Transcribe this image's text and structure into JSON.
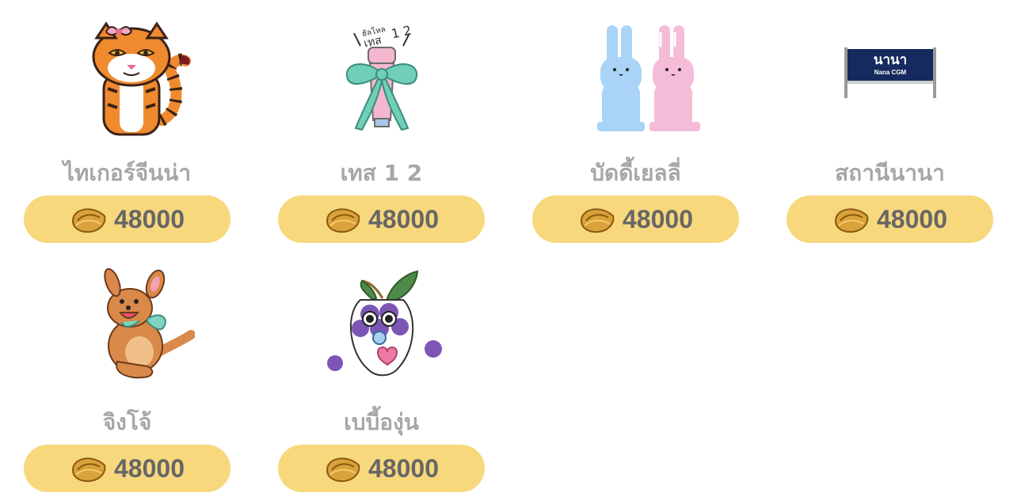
{
  "currency": {
    "icon": "fortune-cookie-icon",
    "color": "#c6952a"
  },
  "items": [
    {
      "name": "ไทเกอร์จีนน่า",
      "price": "48000",
      "icon": "tiger-sticker"
    },
    {
      "name": "เทส 1 2",
      "price": "48000",
      "icon": "microphone-bow-sticker",
      "sticker_text": "ฮัลโหล เทส 1 2"
    },
    {
      "name": "บัดดี้เยลลี่",
      "price": "48000",
      "icon": "jelly-bunnies-sticker"
    },
    {
      "name": "สถานีนานา",
      "price": "48000",
      "icon": "station-sign-sticker",
      "sign_text": "นานา",
      "sign_subtext": "Nana CGM"
    },
    {
      "name": "จิงโจ้",
      "price": "48000",
      "icon": "kangaroo-sticker"
    },
    {
      "name": "เบบี้องุ่น",
      "price": "48000",
      "icon": "baby-grape-sticker"
    }
  ]
}
